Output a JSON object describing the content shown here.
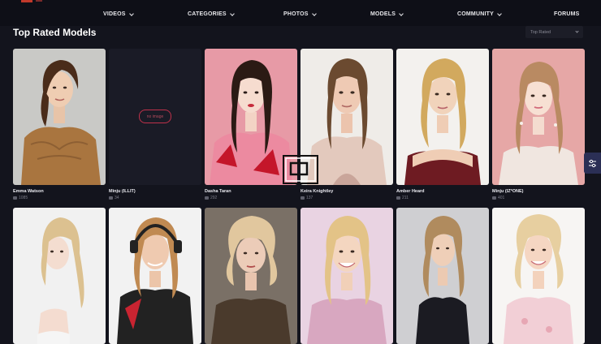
{
  "nav": {
    "items": [
      {
        "label": "VIDEOS",
        "dropdown": true
      },
      {
        "label": "CATEGORIES",
        "dropdown": true
      },
      {
        "label": "PHOTOS",
        "dropdown": true
      },
      {
        "label": "MODELS",
        "dropdown": true
      },
      {
        "label": "COMMUNITY",
        "dropdown": true
      },
      {
        "label": "FORUMS",
        "dropdown": false
      }
    ]
  },
  "page": {
    "title": "Top Rated Models",
    "sort_selected": "Top Rated"
  },
  "models": [
    {
      "name": "Emma Watson",
      "count": "1085"
    },
    {
      "name": "Minju (ILLIT)",
      "count": "34",
      "no_image_label": "no image"
    },
    {
      "name": "Dasha Taran",
      "count": "292"
    },
    {
      "name": "Keira Knightley",
      "count": "137"
    },
    {
      "name": "Amber Heard",
      "count": "211"
    },
    {
      "name": "Minju (IZ*ONE)",
      "count": "401"
    },
    {
      "name": ""
    },
    {
      "name": ""
    },
    {
      "name": ""
    },
    {
      "name": ""
    },
    {
      "name": ""
    },
    {
      "name": ""
    }
  ],
  "colors": {
    "background": "#13141d",
    "nav_background": "#0e0f17",
    "accent_red": "#c0314a",
    "side_button": "#2b2f55"
  },
  "icons": {
    "side_button": "sliders-icon",
    "count": "image-icon",
    "overlay": "picture-in-picture-icon"
  }
}
